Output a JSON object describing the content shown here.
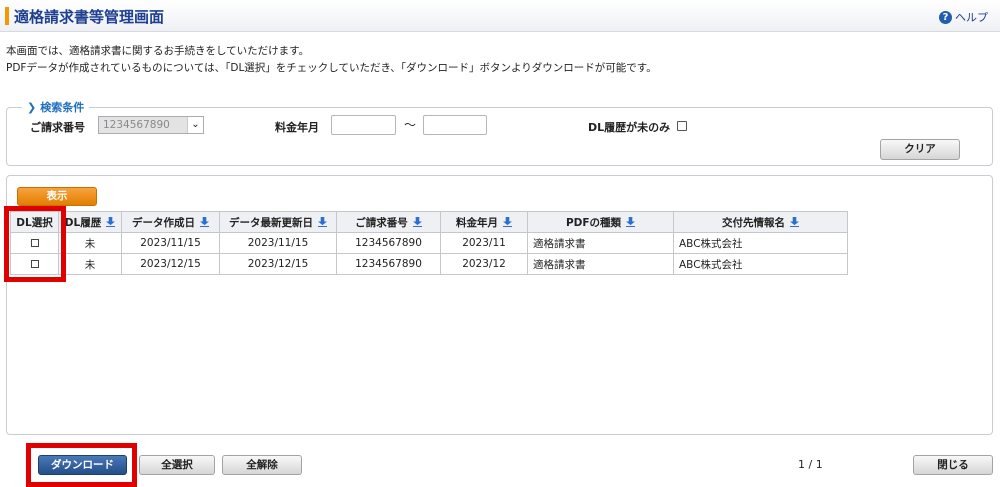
{
  "header": {
    "title": "適格請求書等管理画面",
    "help_label": "ヘルプ"
  },
  "intro": {
    "line1": "本画面では、適格請求書に関するお手続きをしていただけます。",
    "line2": "PDFデータが作成されているものについては、「DL選択」をチェックしていただき、「ダウンロード」ボタンよりダウンロードが可能です。"
  },
  "search": {
    "legend": "検索条件",
    "invoice_no_label": "ご請求番号",
    "invoice_no_value": "1234567890",
    "billing_month_label": "料金年月",
    "range_separator": "〜",
    "dl_history_label": "DL履歴が未のみ",
    "clear_label": "クリア"
  },
  "results": {
    "show_label": "表示",
    "columns": [
      "DL選択",
      "DL履歴",
      "データ作成日",
      "データ最新更新日",
      "ご請求番号",
      "料金年月",
      "PDFの種類",
      "交付先情報名"
    ],
    "rows": [
      {
        "dl_history": "未",
        "created": "2023/11/15",
        "updated": "2023/11/15",
        "invoice_no": "1234567890",
        "month": "2023/11",
        "pdf_type": "適格請求書",
        "recipient": "ABC株式会社"
      },
      {
        "dl_history": "未",
        "created": "2023/12/15",
        "updated": "2023/12/15",
        "invoice_no": "1234567890",
        "month": "2023/12",
        "pdf_type": "適格請求書",
        "recipient": "ABC株式会社"
      }
    ]
  },
  "footer": {
    "download_label": "ダウンロード",
    "select_all_label": "全選択",
    "deselect_all_label": "全解除",
    "page_indicator": "1 / 1",
    "close_label": "閉じる"
  },
  "colors": {
    "accent_orange": "#f39800",
    "title_blue": "#1f3f8f",
    "highlight_red": "#e00000",
    "download_blue": "#2f5f9e"
  }
}
